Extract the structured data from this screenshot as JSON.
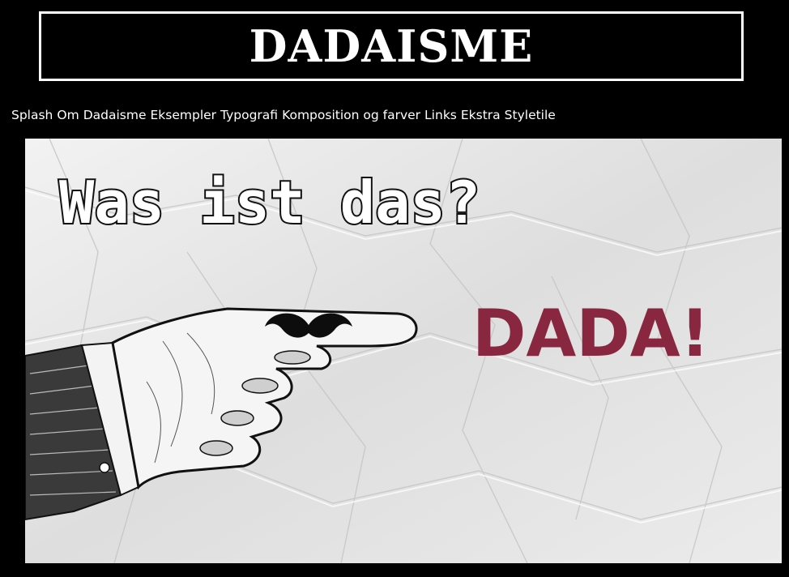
{
  "header": {
    "title": "DADAISME"
  },
  "nav": {
    "items": [
      {
        "label": "Splash"
      },
      {
        "label": "Om"
      },
      {
        "label": "Dadaisme"
      },
      {
        "label": "Eksempler"
      },
      {
        "label": "Typografi"
      },
      {
        "label": "Komposition og farver"
      },
      {
        "label": "Links"
      },
      {
        "label": "Ekstra"
      },
      {
        "label": "Styletile"
      }
    ]
  },
  "hero": {
    "headline": "Was ist das?",
    "answer": "DADA!",
    "answer_color": "#8a2740",
    "paper_color": "#e4e4e4",
    "icons": [
      "pointing-hand-icon",
      "mustache-icon"
    ]
  },
  "colors": {
    "background": "#000000",
    "text": "#ffffff"
  }
}
